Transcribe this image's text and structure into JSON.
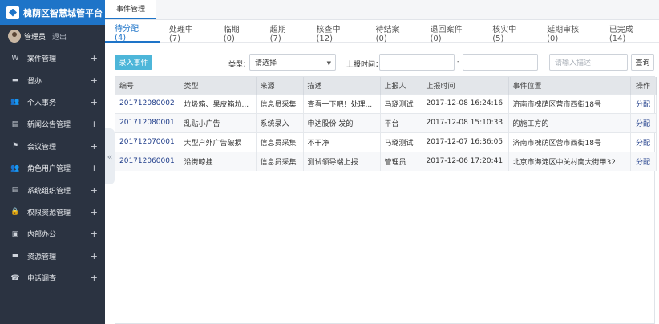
{
  "brand": {
    "title": "槐荫区智慧城管平台"
  },
  "user": {
    "name": "管理员",
    "logout": "退出"
  },
  "sidebar": {
    "items": [
      {
        "icon": "W",
        "label": "案件管理"
      },
      {
        "icon": "▬",
        "label": "督办"
      },
      {
        "icon": "👥",
        "label": "个人事务"
      },
      {
        "icon": "▤",
        "label": "新闻公告管理"
      },
      {
        "icon": "⚑",
        "label": "会议管理"
      },
      {
        "icon": "👥",
        "label": "角色用户管理"
      },
      {
        "icon": "▤",
        "label": "系统组织管理"
      },
      {
        "icon": "🔒",
        "label": "权限资源管理"
      },
      {
        "icon": "▣",
        "label": "内部办公"
      },
      {
        "icon": "▬",
        "label": "资源管理"
      },
      {
        "icon": "☎",
        "label": "电话调查"
      }
    ],
    "plus": "+"
  },
  "collapse": {
    "glyph": "«"
  },
  "top_tab": {
    "label": "事件管理"
  },
  "status_tabs": [
    {
      "label": "待分配(4)",
      "active": true
    },
    {
      "label": "处理中(7)"
    },
    {
      "label": "临期(0)"
    },
    {
      "label": "超期(7)"
    },
    {
      "label": "核查中(12)"
    },
    {
      "label": "待结案(0)"
    },
    {
      "label": "退回案件(0)"
    },
    {
      "label": "核实中(5)"
    },
    {
      "label": "延期审核(0)"
    },
    {
      "label": "已完成(14)"
    }
  ],
  "toolbar": {
    "add_label": "录入事件",
    "type_label": "类型：",
    "type_value": "请选择",
    "time_label": "上报时间：",
    "date_sep": "-",
    "search_placeholder": "请输入描述",
    "search_label": "查询"
  },
  "table": {
    "headers": [
      "编号",
      "类型",
      "来源",
      "描述",
      "上报人",
      "上报时间",
      "事件位置",
      "操作"
    ],
    "rows": [
      [
        "201712080002",
        "垃圾箱、果皮箱垃...",
        "信息员采集",
        "查看一下吧！处理...",
        "马璐测试",
        "2017-12-08 16:24:16",
        "济南市槐荫区营市西街18号",
        "分配"
      ],
      [
        "201712080001",
        "乱贴小广告",
        "系统录入",
        "申达股份 发的",
        "平台",
        "2017-12-08 15:10:33",
        "的施工方的",
        "分配"
      ],
      [
        "201712070001",
        "大型户外广告破损",
        "信息员采集",
        "不干净",
        "马璐测试",
        "2017-12-07 16:36:05",
        "济南市槐荫区营市西街18号",
        "分配"
      ],
      [
        "201712060001",
        "沿街晾挂",
        "信息员采集",
        "测试领导端上报",
        "管理员",
        "2017-12-06 17:20:41",
        "北京市海淀区中关村南大街甲32",
        "分配"
      ]
    ]
  }
}
